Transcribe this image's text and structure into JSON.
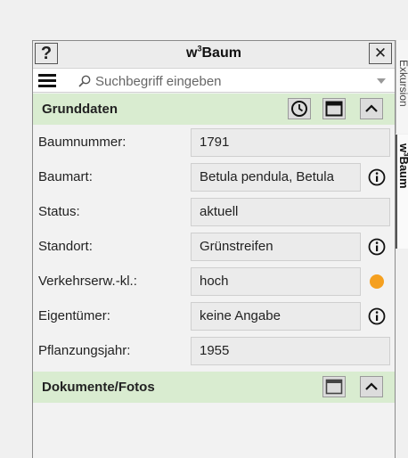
{
  "panel": {
    "title_main": "w",
    "title_sup": "3",
    "title_rest": "Baum",
    "help_label": "?",
    "close_label": "✕"
  },
  "search": {
    "placeholder": "Suchbegriff eingeben"
  },
  "grunddaten": {
    "title": "Grunddaten",
    "rows": [
      {
        "label": "Baumnummer:",
        "value": "1791"
      },
      {
        "label": "Baumart:",
        "value": "Betula pendula, Betula"
      },
      {
        "label": "Status:",
        "value": "aktuell"
      },
      {
        "label": "Standort:",
        "value": "Grünstreifen"
      },
      {
        "label": "Verkehrserw.-kl.:",
        "value": "hoch"
      },
      {
        "label": "Eigentümer:",
        "value": "keine Angabe"
      },
      {
        "label": "Pflanzungsjahr:",
        "value": "1955"
      }
    ]
  },
  "dokumente": {
    "title": "Dokumente/Fotos"
  },
  "sidetabs": {
    "tab1": "Exkursion",
    "tab2": "w³Baum"
  },
  "colors": {
    "section_bg": "#d9ecd0",
    "status_dot": "#f5a020"
  }
}
